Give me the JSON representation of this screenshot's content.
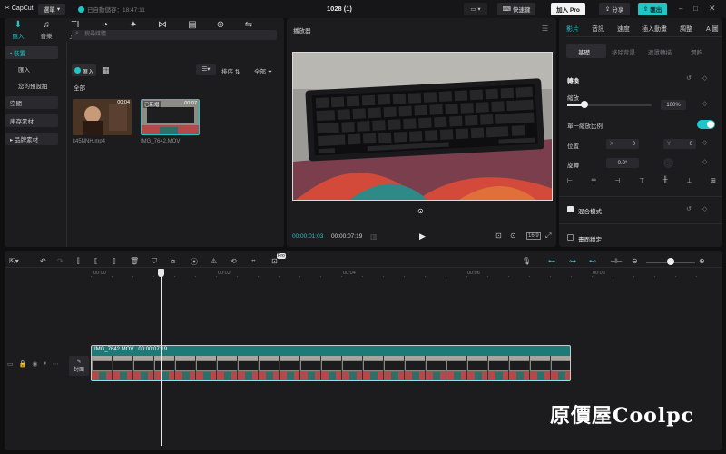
{
  "app": {
    "name": "CapCut",
    "project_title": "1028 (1)"
  },
  "titlebar": {
    "menu_label": "選單",
    "autosave_text": "已自動儲存：18:47:11",
    "shortcut_label": "快速鍵",
    "join_pro_label": "加入 Pro",
    "share_label": "分享",
    "export_label": "匯出"
  },
  "media": {
    "tabs": [
      {
        "label": "匯入",
        "icon": "import-icon"
      },
      {
        "label": "音樂",
        "icon": "music-icon"
      },
      {
        "label": "文字",
        "icon": "text-icon"
      },
      {
        "label": "貼圖",
        "icon": "sticker-icon"
      },
      {
        "label": "特效",
        "icon": "effects-icon"
      },
      {
        "label": "轉場",
        "icon": "transition-icon"
      },
      {
        "label": "字幕",
        "icon": "caption-icon"
      },
      {
        "label": "濾鏡",
        "icon": "filter-icon"
      },
      {
        "label": "調整",
        "icon": "adjust-icon"
      }
    ],
    "sidebar": [
      "• 裝置",
      "匯入",
      "您的預設組",
      "空間",
      "庫存素材",
      "▸ 品牌素材"
    ],
    "search_placeholder": "搜尋媒體",
    "import_label": "匯入",
    "sort_label": "排序",
    "all_filter": "全部",
    "section_label": "全部",
    "items": [
      {
        "name": "k45NNH.mp4",
        "duration": "00:04",
        "badge": ""
      },
      {
        "name": "IMG_7642.MOV",
        "duration": "00:07",
        "badge": "已新增"
      }
    ]
  },
  "player": {
    "title": "播放器",
    "current_time": "00:00:01:03",
    "total_time": "00:00:07:19"
  },
  "inspector": {
    "tabs": [
      "影片",
      "音訊",
      "速度",
      "插入動畫",
      "調整",
      "AI圖"
    ],
    "subtabs": [
      "基礎",
      "移除背景",
      "遮罩轉描",
      "潤飾"
    ],
    "transform_label": "轉換",
    "scale_label": "縮放",
    "scale_value": 100,
    "scale_value_text": "100%",
    "uniform_scale_label": "單一縮放比例",
    "position_label": "位置",
    "pos_x_label": "X",
    "pos_x": "0",
    "pos_y_label": "Y",
    "pos_y": "0",
    "rotation_label": "旋轉",
    "rotation": "0.0°",
    "blend_label": "混合模式",
    "stabilize_label": "畫面穩定"
  },
  "timeline": {
    "ruler": [
      "00:00",
      "00:02",
      "00:04",
      "00:06",
      "00:08"
    ],
    "clip_name": "IMG_7642.MOV",
    "clip_duration": "00:00:07:19",
    "cover_label": "封面",
    "pro_badge": "Pro"
  },
  "watermark": "原價屋Coolpc",
  "colors": {
    "accent": "#1fc6c6",
    "clip": "#1d7a77",
    "pro": "#ffffff"
  }
}
